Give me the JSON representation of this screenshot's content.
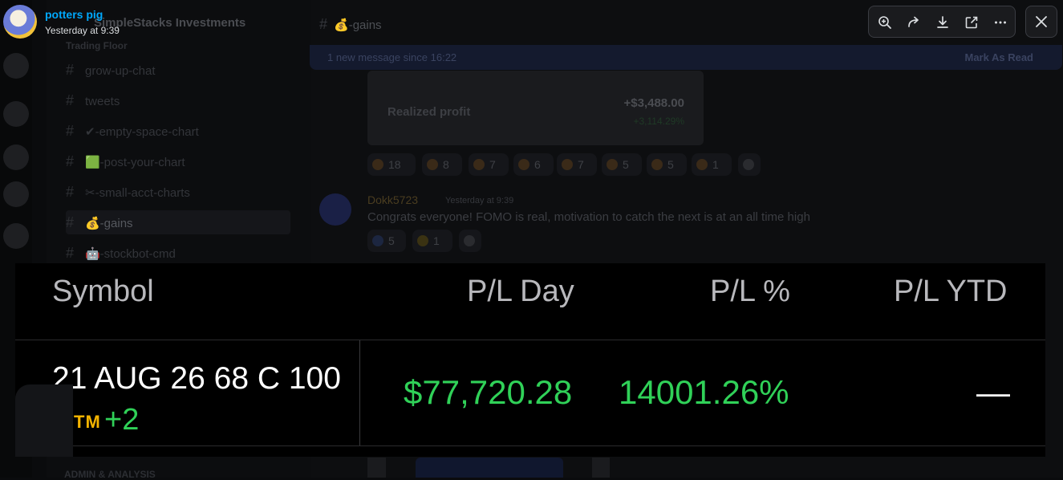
{
  "viewer": {
    "uploader_name": "potters pig",
    "upload_time": "Yesterday at 9:39",
    "toolbar_icons": [
      "zoom-in-icon",
      "forward-icon",
      "download-icon",
      "open-external-icon",
      "more-icon"
    ],
    "close_icon": "close-icon"
  },
  "background": {
    "guild_name": "SimpleStacks Investments",
    "category_top": "Trading Floor",
    "channels": [
      {
        "label": "grow-up-chat"
      },
      {
        "label": "tweets"
      },
      {
        "label": "✔-empty-space-chart"
      },
      {
        "label": "🟩-post-your-chart"
      },
      {
        "label": "✂-small-acct-charts"
      },
      {
        "label": "💰-gains"
      },
      {
        "label": "🤖-stockbot-cmd"
      }
    ],
    "channel_title": "💰-gains",
    "new_message_bar": "1 new message since 16:22",
    "mark_as_read": "Mark As Read",
    "embed": {
      "label": "Realized profit",
      "value": "+$3,488.00",
      "percent": "+3,114.29%"
    },
    "reactions": [
      {
        "count": "18"
      },
      {
        "count": "8"
      },
      {
        "count": "7"
      },
      {
        "count": "6"
      },
      {
        "count": "7"
      },
      {
        "count": "5"
      },
      {
        "count": "5"
      },
      {
        "count": "1"
      }
    ],
    "message": {
      "author": "Dokk5723",
      "time": "Yesterday at 9:39",
      "text": "Congrats everyone! FOMO is real, motivation to catch the next is at an all time high",
      "reactions": [
        {
          "count": "5"
        },
        {
          "count": "1"
        }
      ]
    },
    "bottom_category": "ADMIN & ANALYSIS"
  },
  "image": {
    "headers": {
      "symbol": "Symbol",
      "pl_day": "P/L Day",
      "pl_pct": "P/L %",
      "pl_ytd": "P/L YTD"
    },
    "row": {
      "symbol": "21 AUG 26 68 C 100",
      "badge": "TM",
      "more": "+2",
      "pl_day": "$77,720.28",
      "pl_pct": "14001.26%",
      "pl_ytd": "—"
    },
    "colors": {
      "positive": "#30d158",
      "badge": "#f5b400"
    }
  }
}
